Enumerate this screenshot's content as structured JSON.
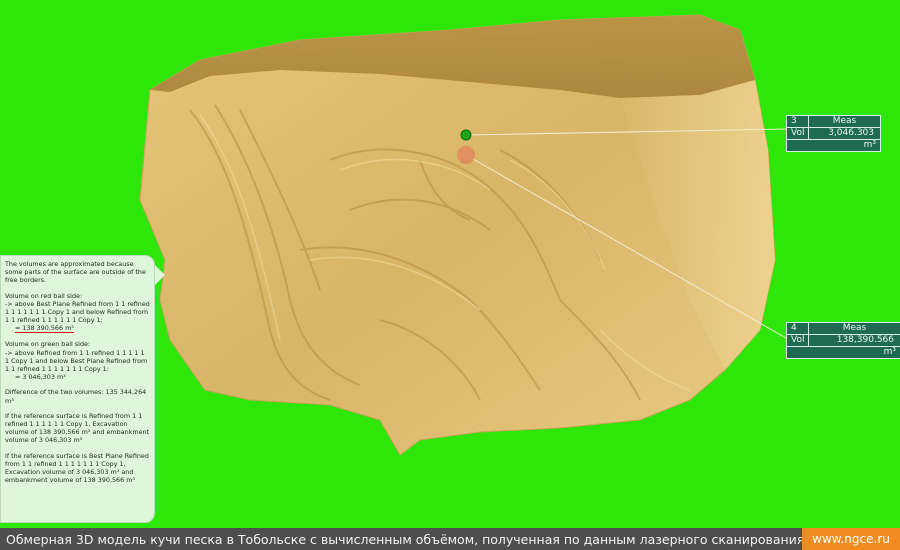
{
  "colors": {
    "background": "#2ee60a",
    "surface": "#d9b56a",
    "panel": "#dff5dc",
    "label_box": "#1f6b52",
    "caption_bar": "#4e4e4e",
    "brand": "#f08c1e"
  },
  "measurements": [
    {
      "id": "3",
      "title": "Meas",
      "key": "Vol",
      "value": "3,046.303",
      "unit": "m³",
      "ball": "green"
    },
    {
      "id": "4",
      "title": "Meas",
      "key": "Vol",
      "value": "138,390.566",
      "unit": "m³",
      "ball": "red"
    }
  ],
  "info": {
    "approx_note": "The volumes are approximated because some parts of the surface are outside of the free borders.",
    "red_heading": "Volume on red ball side:",
    "red_desc": "-> above Best Plane Refined from 1 1 refined 1 1 1 1 1 1 1 Copy 1 and below Refined from 1 1 refined 1 1 1 1 1 1 Copy 1:",
    "red_value": "= 138 390,566 m³",
    "green_heading": "Volume on green ball side:",
    "green_desc": "-> above Refined from 1 1 refined 1 1 1 1 1 1 Copy 1 and below Best Plane Refined from 1 1 refined 1 1 1 1 1 1 1 Copy 1:",
    "green_value": "= 3 046,303 m³",
    "difference": "Difference of the two volumes: 135 344,264 m³",
    "ref1": "If the reference surface is Refined from 1 1 refined 1 1 1 1 1 1 Copy 1, Excavation volume of 138 390,566 m³ and embankment volume of 3 046,303 m³",
    "ref2": "If the reference surface is Best Plane Refined from 1 1 refined 1 1 1 1 1 1 1 Copy 1, Excavation volume of 3 046,303 m³ and embankment volume of 138 390,566 m³"
  },
  "caption": "Обмерная 3D модель кучи песка в Тобольске с вычисленным объёмом, полученная по данным лазерного сканирования",
  "brand": "www.ngce.ru"
}
